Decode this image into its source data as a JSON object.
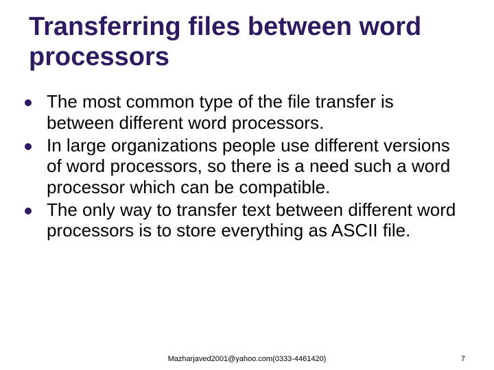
{
  "title": "Transferring files between word processors",
  "bullets": [
    "The most common type of the file transfer is between different word processors.",
    "In large organizations people use different versions of word processors, so there is a need such a word processor which can be compatible.",
    "The only way to transfer text between different word processors is to store everything as ASCII file."
  ],
  "footer": {
    "center": "Mazharjaved2001@yahoo.com(0333-4461420)",
    "page": "7"
  }
}
